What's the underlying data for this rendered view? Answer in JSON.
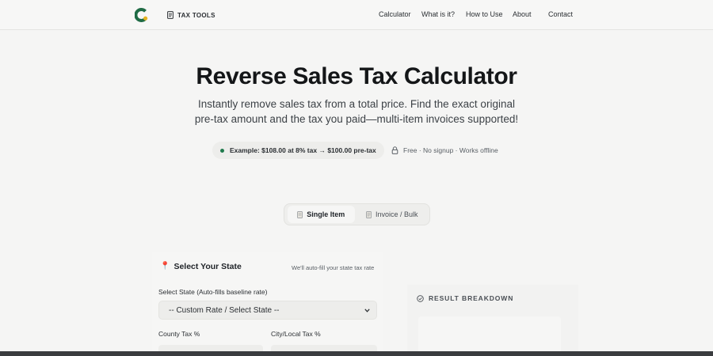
{
  "header": {
    "brand": "TAX TOOLS",
    "nav": [
      "Calculator",
      "What is it?",
      "How to Use",
      "About",
      "Contact"
    ]
  },
  "hero": {
    "title": "Reverse Sales Tax Calculator",
    "subtitle_line1": "Instantly remove sales tax from a total price. Find the exact original",
    "subtitle_line2": "pre-tax amount and the tax you paid—multi-item invoices supported!",
    "example_badge": "Example: $108.00 at 8% tax → $100.00 pre-tax",
    "meta_badge": "Free · No signup · Works offline"
  },
  "tabs": {
    "single": "Single Item",
    "bulk": "Invoice / Bulk",
    "active": "single"
  },
  "state_panel": {
    "title": "Select Your State",
    "hint": "We'll auto-fill your state tax rate",
    "select_label": "Select State (Auto-fills baseline rate)",
    "select_value": "-- Custom Rate / Select State --",
    "county_label": "County Tax %",
    "city_label": "City/Local Tax %"
  },
  "result": {
    "title": "RESULT BREAKDOWN"
  },
  "colors": {
    "accent_green": "#1f7a4d",
    "logo_green": "#1f6b45",
    "logo_yellow": "#e6b422",
    "pin_red": "#d23b3b"
  },
  "icons": {
    "logo": "logo-icon",
    "brand": "document-icon",
    "meta": "lock-icon",
    "state": "pin-icon",
    "result": "check-circle-icon",
    "select": "chevron-down-icon"
  }
}
